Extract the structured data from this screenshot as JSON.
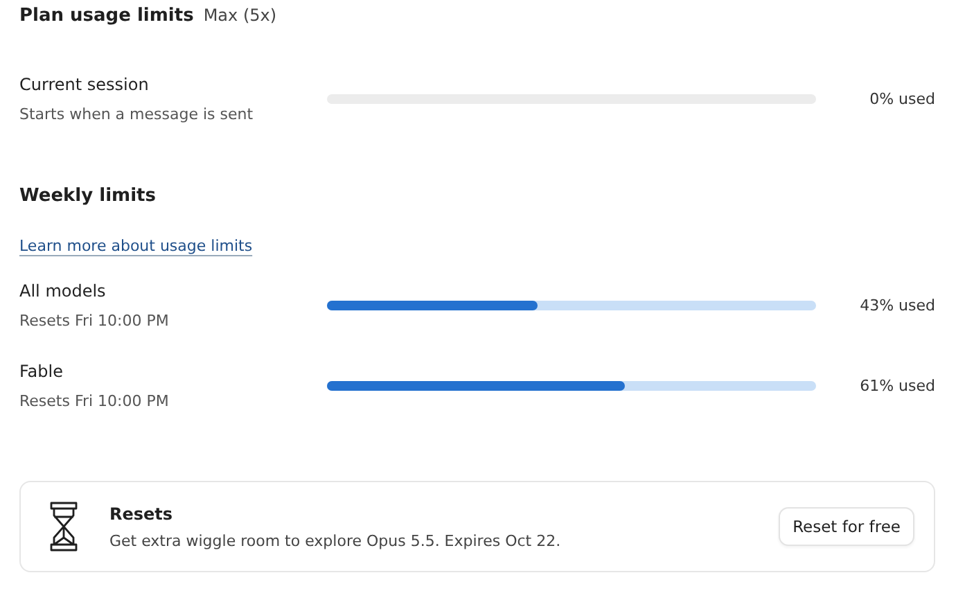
{
  "header": {
    "title": "Plan usage limits",
    "plan": "Max (5x)"
  },
  "current_session": {
    "name": "Current session",
    "detail": "Starts when a message is sent",
    "reading": "0% used"
  },
  "weekly": {
    "title": "Weekly limits",
    "link": "Learn more about usage limits",
    "limits": [
      {
        "name": "All models",
        "detail": "Resets Fri 10:00 PM",
        "level": 0.43,
        "reading": "43% used"
      },
      {
        "name": "Fable",
        "detail": "Resets Fri 10:00 PM",
        "level": 0.61,
        "reading": "61% used"
      }
    ]
  },
  "card": {
    "title": "Resets",
    "text": "Get extra wiggle room to explore Opus 5.5. Expires Oct 22.",
    "button": "Reset for free"
  }
}
